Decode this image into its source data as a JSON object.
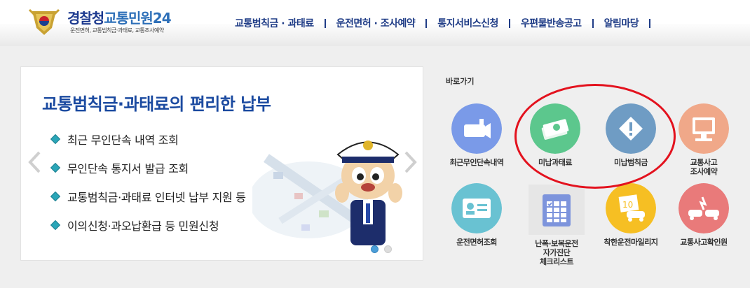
{
  "header": {
    "logo_name_a": "경찰청",
    "logo_name_b": "교통민원24",
    "logo_sub": "운전면허, 교통범칙금·과태료, 교통조사예약"
  },
  "gnb": [
    {
      "label": "교통범칙금 · 과태료"
    },
    {
      "label": "운전면허 · 조사예약"
    },
    {
      "label": "통지서비스신청"
    },
    {
      "label": "우편물반송공고"
    },
    {
      "label": "알림마당"
    }
  ],
  "slider": {
    "title": "교통범칙금·과태료의 편리한 납부",
    "bullets": [
      "최근 무인단속 내역 조회",
      "무인단속 통지서 발급 조회",
      "교통범칙금·과태료 인터넷 납부 지원 등",
      "이의신청·과오납환급 등 민원신청"
    ],
    "current_slide": 1,
    "total_slides": 2
  },
  "quick": {
    "title": "바로가기",
    "items": [
      {
        "label": "최근무인단속내역",
        "color": "#7a9ae8",
        "icon": "camera-icon"
      },
      {
        "label": "미납과태료",
        "color": "#5cc78d",
        "icon": "money-icon"
      },
      {
        "label": "미납범칙금",
        "color": "#6f9cc4",
        "icon": "warning-icon"
      },
      {
        "label": "교통사고\n조사예약",
        "color": "#f0a889",
        "icon": "monitor-icon"
      },
      {
        "label": "운전면허조회",
        "color": "#69c2d2",
        "icon": "id-card-icon"
      },
      {
        "label": "난폭·보복운전\n자가진단\n체크리스트",
        "color": "#7d94dc",
        "icon": "checklist-icon"
      },
      {
        "label": "착한운전마일리지",
        "color": "#f6bf23",
        "icon": "car-mileage-icon"
      },
      {
        "label": "교통사고확인원",
        "color": "#e97a7a",
        "icon": "accident-icon"
      }
    ]
  },
  "colors": {
    "brand": "#1f3c86",
    "accent": "#2aa6b8",
    "highlight": "#e3121e"
  }
}
